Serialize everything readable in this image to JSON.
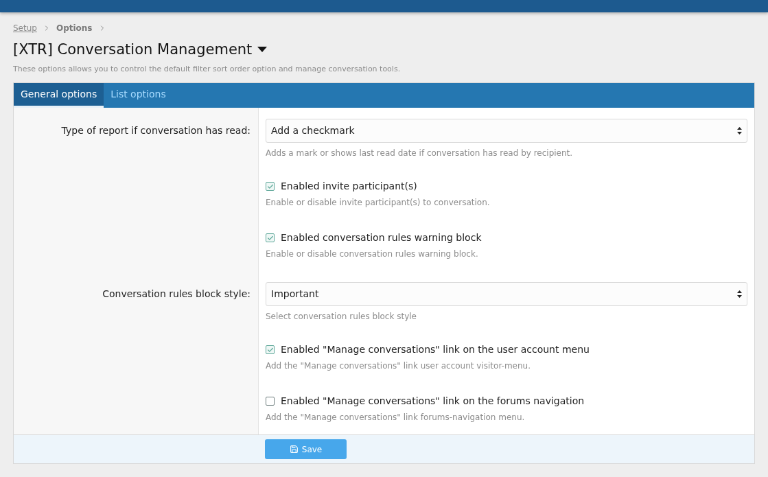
{
  "breadcrumb": [
    "Setup",
    "Options"
  ],
  "title": "[XTR] Conversation Management",
  "description": "These options allows you to control the default filter sort order option and manage conversation tools.",
  "tabs": [
    {
      "label": "General options",
      "selected": true
    },
    {
      "label": "List options",
      "selected": false
    }
  ],
  "options": [
    {
      "kind": "select",
      "label": "Type of report if conversation has read:",
      "value": "Add a checkmark",
      "hint": "Adds a mark or shows last read date if conversation has read by recipient."
    },
    {
      "kind": "checkbox",
      "label": "Enabled invite participant(s)",
      "checked": true,
      "hint": "Enable or disable invite participant(s) to conversation."
    },
    {
      "kind": "checkbox",
      "label": "Enabled conversation rules warning block",
      "checked": true,
      "hint": "Enable or disable conversation rules warning block."
    },
    {
      "kind": "select",
      "label": "Conversation rules block style:",
      "value": "Important",
      "hint": "Select conversation rules block style"
    },
    {
      "kind": "checkbox",
      "label": "Enabled \"Manage conversations\" link on the user account menu",
      "checked": true,
      "hint": "Add the \"Manage conversations\" link user account visitor-menu."
    },
    {
      "kind": "checkbox",
      "label": "Enabled \"Manage conversations\" link on the forums navigation",
      "checked": false,
      "hint": "Add the \"Manage conversations\" link forums-navigation menu."
    }
  ],
  "save_button": "Save"
}
